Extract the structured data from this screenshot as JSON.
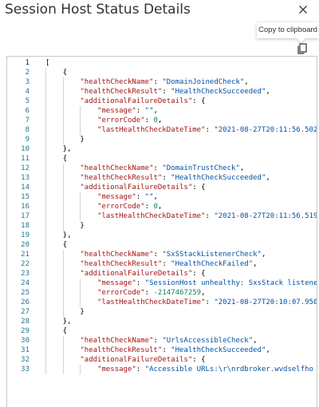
{
  "panel": {
    "title": "Session Host Status Details"
  },
  "tooltip": {
    "text": "Copy to clipboard"
  },
  "icons": {
    "close": "close-icon",
    "copy": "copy-icon"
  },
  "colors": {
    "line_number": "#237893",
    "json_key": "#a31515",
    "json_string": "#0451a5",
    "json_number": "#098658"
  },
  "code_lines": [
    {
      "n": "1",
      "tokens": [
        {
          "t": "p",
          "v": "["
        }
      ]
    },
    {
      "n": "2",
      "tokens": [
        {
          "t": "p",
          "v": "    {"
        }
      ]
    },
    {
      "n": "3",
      "tokens": [
        {
          "t": "p",
          "v": "        "
        },
        {
          "t": "k",
          "v": "\"healthCheckName\""
        },
        {
          "t": "p",
          "v": ": "
        },
        {
          "t": "s",
          "v": "\"DomainJoinedCheck\""
        },
        {
          "t": "p",
          "v": ","
        }
      ]
    },
    {
      "n": "4",
      "tokens": [
        {
          "t": "p",
          "v": "        "
        },
        {
          "t": "k",
          "v": "\"healthCheckResult\""
        },
        {
          "t": "p",
          "v": ": "
        },
        {
          "t": "s",
          "v": "\"HealthCheckSucceeded\""
        },
        {
          "t": "p",
          "v": ","
        }
      ]
    },
    {
      "n": "5",
      "tokens": [
        {
          "t": "p",
          "v": "        "
        },
        {
          "t": "k",
          "v": "\"additionalFailureDetails\""
        },
        {
          "t": "p",
          "v": ": {"
        }
      ]
    },
    {
      "n": "6",
      "tokens": [
        {
          "t": "p",
          "v": "            "
        },
        {
          "t": "k",
          "v": "\"message\""
        },
        {
          "t": "p",
          "v": ": "
        },
        {
          "t": "s",
          "v": "\"\""
        },
        {
          "t": "p",
          "v": ","
        }
      ]
    },
    {
      "n": "7",
      "tokens": [
        {
          "t": "p",
          "v": "            "
        },
        {
          "t": "k",
          "v": "\"errorCode\""
        },
        {
          "t": "p",
          "v": ": "
        },
        {
          "t": "n",
          "v": "0"
        },
        {
          "t": "p",
          "v": ","
        }
      ]
    },
    {
      "n": "8",
      "tokens": [
        {
          "t": "p",
          "v": "            "
        },
        {
          "t": "k",
          "v": "\"lastHealthCheckDateTime\""
        },
        {
          "t": "p",
          "v": ": "
        },
        {
          "t": "s",
          "v": "\"2021-08-27T20:11:56.502"
        }
      ]
    },
    {
      "n": "9",
      "tokens": [
        {
          "t": "p",
          "v": "        }"
        }
      ]
    },
    {
      "n": "10",
      "tokens": [
        {
          "t": "p",
          "v": "    },"
        }
      ]
    },
    {
      "n": "11",
      "tokens": [
        {
          "t": "p",
          "v": "    {"
        }
      ]
    },
    {
      "n": "12",
      "tokens": [
        {
          "t": "p",
          "v": "        "
        },
        {
          "t": "k",
          "v": "\"healthCheckName\""
        },
        {
          "t": "p",
          "v": ": "
        },
        {
          "t": "s",
          "v": "\"DomainTrustCheck\""
        },
        {
          "t": "p",
          "v": ","
        }
      ]
    },
    {
      "n": "13",
      "tokens": [
        {
          "t": "p",
          "v": "        "
        },
        {
          "t": "k",
          "v": "\"healthCheckResult\""
        },
        {
          "t": "p",
          "v": ": "
        },
        {
          "t": "s",
          "v": "\"HealthCheckSucceeded\""
        },
        {
          "t": "p",
          "v": ","
        }
      ]
    },
    {
      "n": "14",
      "tokens": [
        {
          "t": "p",
          "v": "        "
        },
        {
          "t": "k",
          "v": "\"additionalFailureDetails\""
        },
        {
          "t": "p",
          "v": ": {"
        }
      ]
    },
    {
      "n": "15",
      "tokens": [
        {
          "t": "p",
          "v": "            "
        },
        {
          "t": "k",
          "v": "\"message\""
        },
        {
          "t": "p",
          "v": ": "
        },
        {
          "t": "s",
          "v": "\"\""
        },
        {
          "t": "p",
          "v": ","
        }
      ]
    },
    {
      "n": "16",
      "tokens": [
        {
          "t": "p",
          "v": "            "
        },
        {
          "t": "k",
          "v": "\"errorCode\""
        },
        {
          "t": "p",
          "v": ": "
        },
        {
          "t": "n",
          "v": "0"
        },
        {
          "t": "p",
          "v": ","
        }
      ]
    },
    {
      "n": "17",
      "tokens": [
        {
          "t": "p",
          "v": "            "
        },
        {
          "t": "k",
          "v": "\"lastHealthCheckDateTime\""
        },
        {
          "t": "p",
          "v": ": "
        },
        {
          "t": "s",
          "v": "\"2021-08-27T20:11:56.519"
        }
      ]
    },
    {
      "n": "18",
      "tokens": [
        {
          "t": "p",
          "v": "        }"
        }
      ]
    },
    {
      "n": "19",
      "tokens": [
        {
          "t": "p",
          "v": "    },"
        }
      ]
    },
    {
      "n": "20",
      "tokens": [
        {
          "t": "p",
          "v": "    {"
        }
      ]
    },
    {
      "n": "21",
      "tokens": [
        {
          "t": "p",
          "v": "        "
        },
        {
          "t": "k",
          "v": "\"healthCheckName\""
        },
        {
          "t": "p",
          "v": ": "
        },
        {
          "t": "s",
          "v": "\"SxSStackListenerCheck\""
        },
        {
          "t": "p",
          "v": ","
        }
      ]
    },
    {
      "n": "22",
      "tokens": [
        {
          "t": "p",
          "v": "        "
        },
        {
          "t": "k",
          "v": "\"healthCheckResult\""
        },
        {
          "t": "p",
          "v": ": "
        },
        {
          "t": "s",
          "v": "\"HealthCheckFailed\""
        },
        {
          "t": "p",
          "v": ","
        }
      ]
    },
    {
      "n": "23",
      "tokens": [
        {
          "t": "p",
          "v": "        "
        },
        {
          "t": "k",
          "v": "\"additionalFailureDetails\""
        },
        {
          "t": "p",
          "v": ": {"
        }
      ]
    },
    {
      "n": "24",
      "tokens": [
        {
          "t": "p",
          "v": "            "
        },
        {
          "t": "k",
          "v": "\"message\""
        },
        {
          "t": "p",
          "v": ": "
        },
        {
          "t": "s",
          "v": "\"SessionHost unhealthy: SxsStack listene"
        }
      ]
    },
    {
      "n": "25",
      "tokens": [
        {
          "t": "p",
          "v": "            "
        },
        {
          "t": "k",
          "v": "\"errorCode\""
        },
        {
          "t": "p",
          "v": ": "
        },
        {
          "t": "n",
          "v": "-2147467259"
        },
        {
          "t": "p",
          "v": ","
        }
      ]
    },
    {
      "n": "26",
      "tokens": [
        {
          "t": "p",
          "v": "            "
        },
        {
          "t": "k",
          "v": "\"lastHealthCheckDateTime\""
        },
        {
          "t": "p",
          "v": ": "
        },
        {
          "t": "s",
          "v": "\"2021-08-27T20:10:07.950"
        }
      ]
    },
    {
      "n": "27",
      "tokens": [
        {
          "t": "p",
          "v": "        }"
        }
      ]
    },
    {
      "n": "28",
      "tokens": [
        {
          "t": "p",
          "v": "    },"
        }
      ]
    },
    {
      "n": "29",
      "tokens": [
        {
          "t": "p",
          "v": "    {"
        }
      ]
    },
    {
      "n": "30",
      "tokens": [
        {
          "t": "p",
          "v": "        "
        },
        {
          "t": "k",
          "v": "\"healthCheckName\""
        },
        {
          "t": "p",
          "v": ": "
        },
        {
          "t": "s",
          "v": "\"UrlsAccessibleCheck\""
        },
        {
          "t": "p",
          "v": ","
        }
      ]
    },
    {
      "n": "31",
      "tokens": [
        {
          "t": "p",
          "v": "        "
        },
        {
          "t": "k",
          "v": "\"healthCheckResult\""
        },
        {
          "t": "p",
          "v": ": "
        },
        {
          "t": "s",
          "v": "\"HealthCheckSucceeded\""
        },
        {
          "t": "p",
          "v": ","
        }
      ]
    },
    {
      "n": "32",
      "tokens": [
        {
          "t": "p",
          "v": "        "
        },
        {
          "t": "k",
          "v": "\"additionalFailureDetails\""
        },
        {
          "t": "p",
          "v": ": {"
        }
      ]
    },
    {
      "n": "33",
      "tokens": [
        {
          "t": "p",
          "v": "            "
        },
        {
          "t": "k",
          "v": "\"message\""
        },
        {
          "t": "p",
          "v": ": "
        },
        {
          "t": "s",
          "v": "\"Accessible URLs:\\r\\nrdbroker.wvdselfho"
        }
      ]
    }
  ]
}
